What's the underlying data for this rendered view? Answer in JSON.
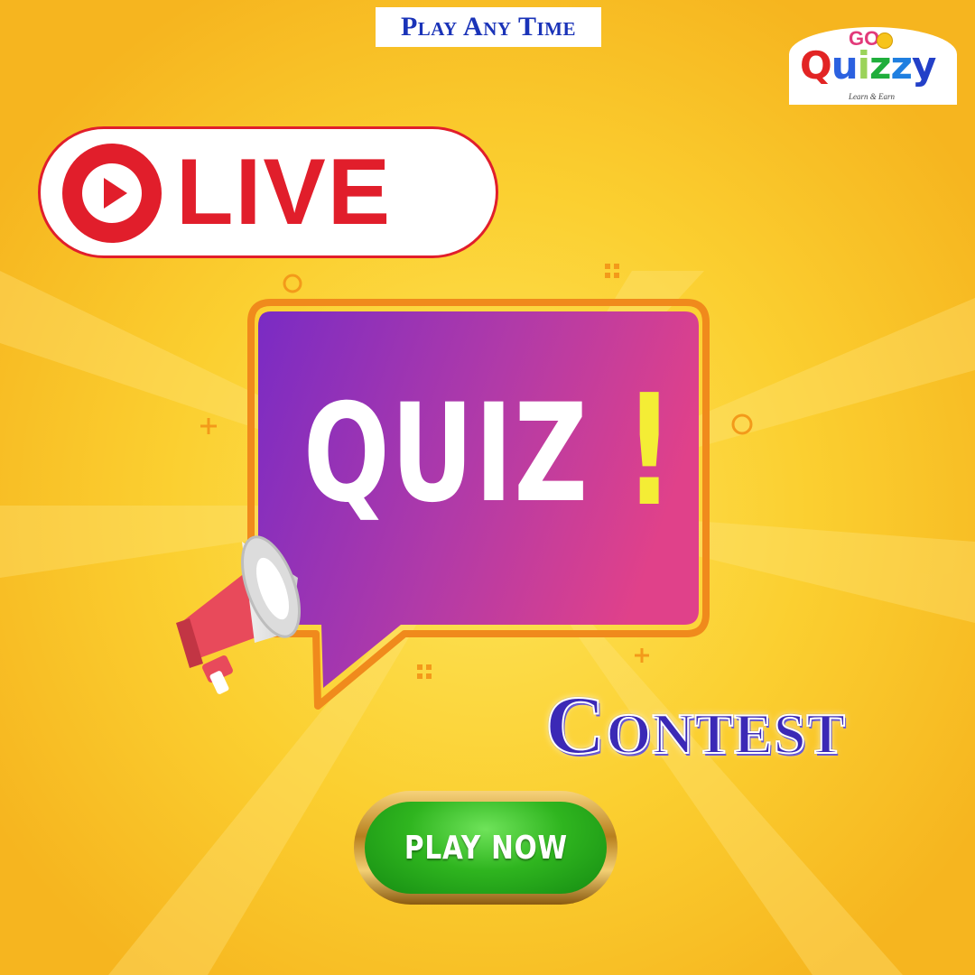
{
  "banner": {
    "text": "Play Any Time"
  },
  "logo": {
    "go": "GO",
    "name_parts": [
      {
        "text": "Q",
        "color": "#e22424"
      },
      {
        "text": "u",
        "color": "#2b61e0"
      },
      {
        "text": "i",
        "color": "#9bd35a"
      },
      {
        "text": "z",
        "color": "#1fae3b"
      },
      {
        "text": "z",
        "color": "#1f7fe0"
      },
      {
        "text": "y",
        "color": "#2340c8"
      }
    ],
    "tagline": "Learn & Earn"
  },
  "live": {
    "label": "LIVE",
    "icon": "play-circle-icon",
    "color": "#e11e2b"
  },
  "quiz": {
    "word": "QUIZ",
    "exclamation": "!",
    "icon": "megaphone-icon"
  },
  "contest": {
    "label": "Contest"
  },
  "cta": {
    "label": "PLAY NOW"
  },
  "colors": {
    "background": "#f9c22a",
    "bubble_start": "#7a2bc4",
    "bubble_end": "#e0418a",
    "accent_yellow": "#f4ed35",
    "button_green": "#2fb51f"
  }
}
